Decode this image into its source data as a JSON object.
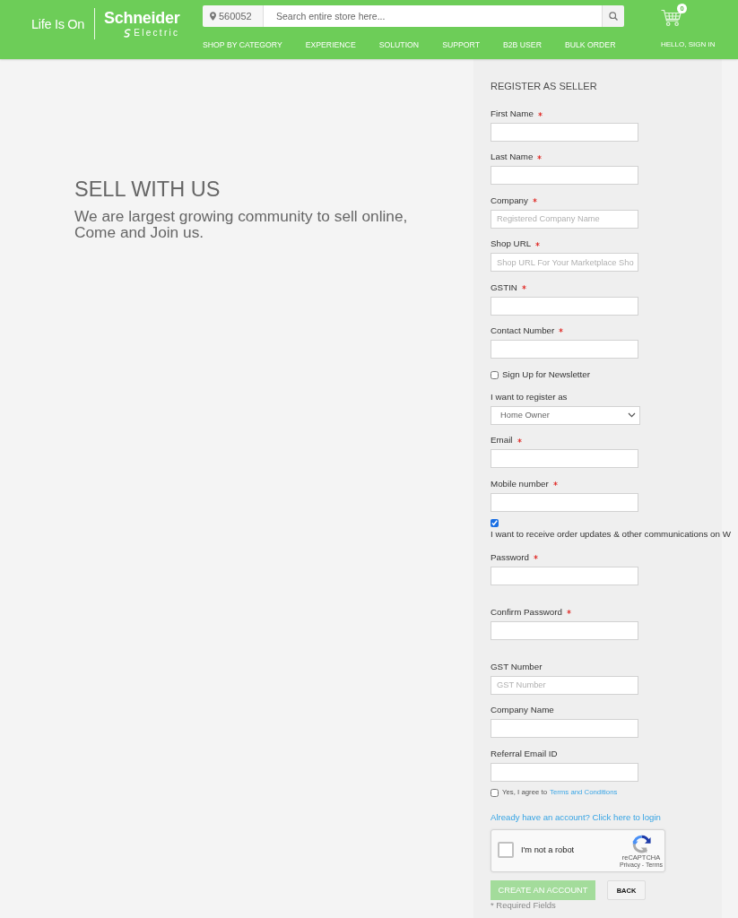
{
  "header": {
    "tagline": "Life Is On",
    "brand": {
      "name": "Schneider",
      "subname": "Electric"
    },
    "location": {
      "value": "560052"
    },
    "search": {
      "placeholder": "Search entire store here..."
    },
    "cart": {
      "count": "0"
    },
    "nav": [
      {
        "label": "SHOP BY CATEGORY"
      },
      {
        "label": "EXPERIENCE"
      },
      {
        "label": "SOLUTION"
      },
      {
        "label": "SUPPORT"
      },
      {
        "label": "B2B USER"
      },
      {
        "label": "BULK ORDER"
      }
    ],
    "account_link": "HELLO, SIGN IN"
  },
  "intro": {
    "title": "SELL WITH US",
    "text": "We are largest growing community to sell online, Come and Join us."
  },
  "form": {
    "title": "REGISTER AS SELLER",
    "items": [
      {
        "kind": "text",
        "label": "First Name",
        "required": true
      },
      {
        "kind": "text",
        "label": "Last Name",
        "required": true
      },
      {
        "kind": "text",
        "label": "Company",
        "required": true,
        "placeholder": "Registered Company Name"
      },
      {
        "kind": "text",
        "label": "Shop URL",
        "required": true,
        "placeholder": "Shop URL For Your Marketplace Sho"
      },
      {
        "kind": "text",
        "label": "GSTIN",
        "required": true
      },
      {
        "kind": "text",
        "label": "Contact Number",
        "required": true
      },
      {
        "kind": "checkbox",
        "label": "Sign Up for Newsletter",
        "checked": false
      },
      {
        "kind": "select",
        "label": "I want to register as",
        "required": false,
        "value": "Home Owner"
      },
      {
        "kind": "text",
        "label": "Email",
        "required": true
      },
      {
        "kind": "text",
        "label": "Mobile number",
        "required": true
      },
      {
        "kind": "consent",
        "label": "I want to receive order updates & other communications on W",
        "checked": true
      },
      {
        "kind": "password",
        "label": "Password",
        "required": true
      },
      {
        "kind": "password",
        "label": "Confirm Password",
        "required": true
      },
      {
        "kind": "text",
        "label": "GST Number",
        "required": false,
        "placeholder": "GST Number"
      },
      {
        "kind": "text",
        "label": "Company Name",
        "required": false
      },
      {
        "kind": "text",
        "label": "Referral Email ID",
        "required": false
      },
      {
        "kind": "terms",
        "label": "Yes, I agree to",
        "link": "Terms and Conditions",
        "checked": false
      }
    ],
    "login_link": "Already have an account? Click here to login",
    "captcha": {
      "label": "I'm not a robot",
      "checked": false,
      "brand": "reCAPTCHA",
      "links": "Privacy - Terms"
    },
    "buttons": [
      {
        "kind": "primary",
        "label": "CREATE AN ACCOUNT",
        "disabled": true
      },
      {
        "kind": "secondary",
        "label": "BACK"
      }
    ],
    "note": "* Required Fields"
  }
}
